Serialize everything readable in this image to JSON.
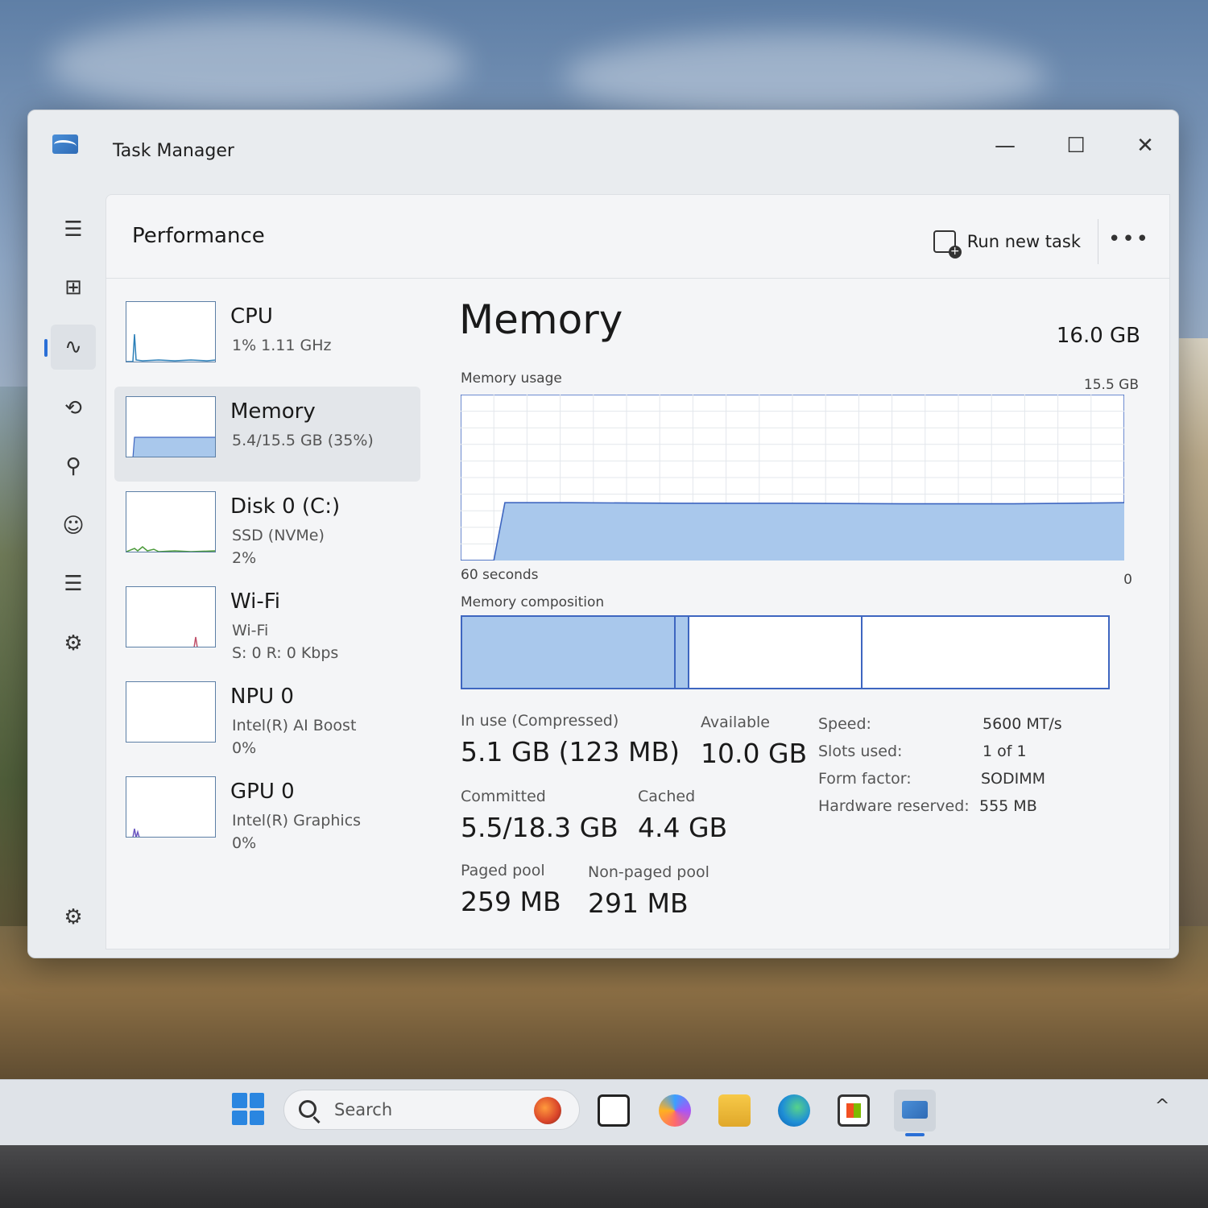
{
  "window": {
    "title": "Task Manager",
    "controls": {
      "minimize": "—",
      "maximize": "☐",
      "close": "✕"
    }
  },
  "nav": {
    "icons": [
      "hamburger-icon",
      "processes-icon",
      "performance-icon",
      "app-history-icon",
      "startup-apps-icon",
      "users-icon",
      "details-icon",
      "services-icon",
      "settings-icon"
    ],
    "glyphs": {
      "hamburger": "☰",
      "processes": "⊞",
      "performance": "∿",
      "history": "⟲",
      "startup": "⚲",
      "users": "☺",
      "details": "☰",
      "services": "⚙",
      "settings": "⚙"
    }
  },
  "header": {
    "title": "Performance",
    "run_new_task": "Run new task",
    "more": "•••"
  },
  "resources": [
    {
      "name": "CPU",
      "sub1": "1%  1.11 GHz",
      "sub2": ""
    },
    {
      "name": "Memory",
      "sub1": "5.4/15.5 GB (35%)",
      "sub2": ""
    },
    {
      "name": "Disk 0 (C:)",
      "sub1": "SSD (NVMe)",
      "sub2": "2%"
    },
    {
      "name": "Wi-Fi",
      "sub1": "Wi-Fi",
      "sub2": "S: 0  R: 0 Kbps"
    },
    {
      "name": "NPU 0",
      "sub1": "Intel(R) AI Boost",
      "sub2": "0%"
    },
    {
      "name": "GPU 0",
      "sub1": "Intel(R) Graphics",
      "sub2": "0%"
    }
  ],
  "memory": {
    "title": "Memory",
    "total": "16.0 GB",
    "usage_label": "Memory usage",
    "usage_max": "15.5 GB",
    "x_label": "60 seconds",
    "x_zero": "0",
    "composition_label": "Memory composition",
    "stats": {
      "in_use_label": "In use (Compressed)",
      "in_use_value": "5.1 GB (123 MB)",
      "available_label": "Available",
      "available_value": "10.0 GB",
      "committed_label": "Committed",
      "committed_value": "5.5/18.3 GB",
      "cached_label": "Cached",
      "cached_value": "4.4 GB",
      "paged_label": "Paged pool",
      "paged_value": "259 MB",
      "nonpaged_label": "Non-paged pool",
      "nonpaged_value": "291 MB"
    },
    "specs": {
      "speed_label": "Speed:",
      "speed_value": "5600 MT/s",
      "slots_label": "Slots used:",
      "slots_value": "1 of 1",
      "form_label": "Form factor:",
      "form_value": "SODIMM",
      "reserved_label": "Hardware reserved:",
      "reserved_value": "555 MB"
    },
    "composition_segments": [
      {
        "kind": "in-use",
        "fraction": 0.33,
        "filled": true
      },
      {
        "kind": "modified",
        "fraction": 0.022,
        "filled": true
      },
      {
        "kind": "standby",
        "fraction": 0.268,
        "filled": false
      },
      {
        "kind": "free",
        "fraction": 0.38,
        "filled": false
      }
    ],
    "accent": "#3e66c0",
    "fill": "#a9c8ec"
  },
  "chart_data": {
    "type": "area",
    "title": "Memory usage",
    "xlabel": "60 seconds",
    "ylabel": "",
    "x": [
      60,
      57,
      56,
      50,
      40,
      30,
      20,
      10,
      5,
      0
    ],
    "values": [
      0,
      0,
      5.4,
      5.4,
      5.35,
      5.35,
      5.3,
      5.3,
      5.35,
      5.4
    ],
    "xlim": [
      60,
      0
    ],
    "ylim": [
      0,
      15.5
    ],
    "grid": true
  },
  "taskbar": {
    "search_placeholder": "Search",
    "apps": [
      "start-icon",
      "file-explorer-icon",
      "copilot-icon",
      "files-icon",
      "edge-icon",
      "store-icon",
      "task-manager-icon"
    ],
    "tray_chevron": "^"
  },
  "colors": {
    "cpu_line": "#2b7fb8",
    "disk_line": "#4c9a3a",
    "wifi_line": "#c0506a",
    "gpu_line": "#6a56c0",
    "memory_fill": "#a9c8ec"
  }
}
